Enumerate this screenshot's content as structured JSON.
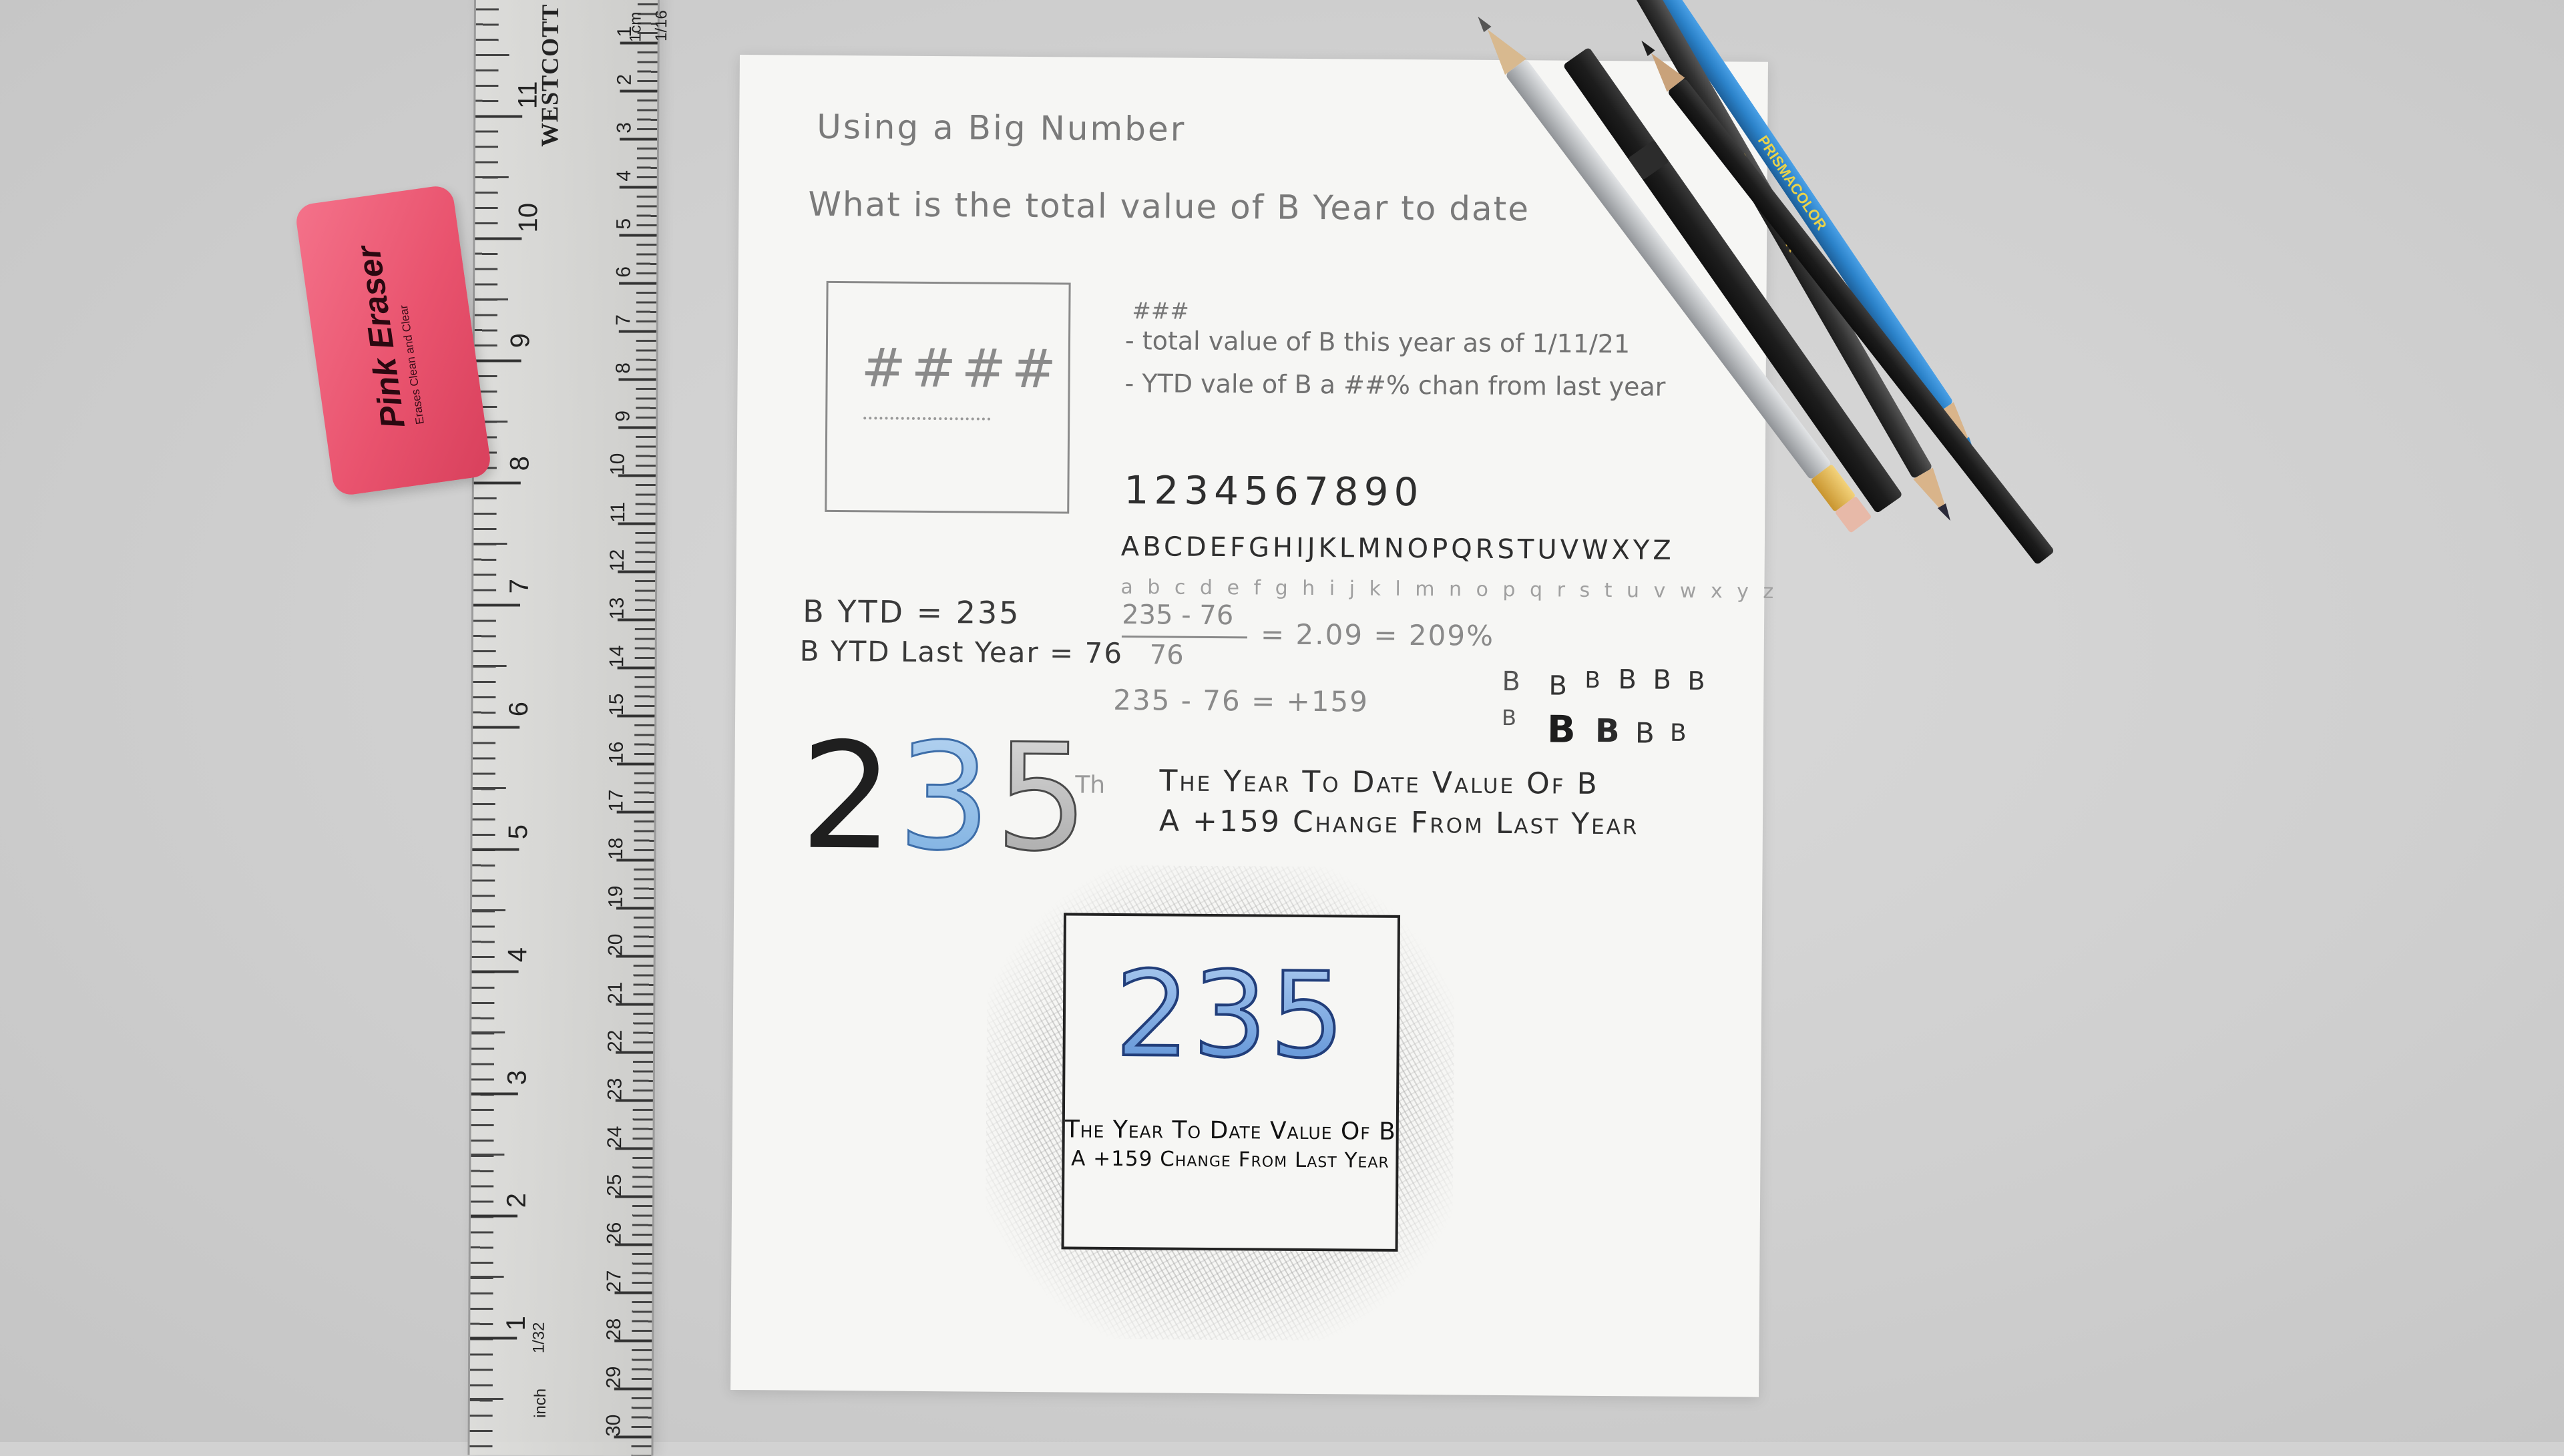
{
  "desk": {
    "color": "#d2d2d2"
  },
  "ruler": {
    "brand": "WESTCOTT",
    "unit_top": "1cm",
    "unit_bottom": "inch",
    "fraction_label": "1/32",
    "small_label": "1/16",
    "inch_numbers": [
      "11",
      "10",
      "9",
      "8",
      "7",
      "6",
      "5",
      "4",
      "3",
      "2",
      "1"
    ],
    "cm_numbers": [
      "1",
      "2",
      "3",
      "4",
      "5",
      "6",
      "7",
      "8",
      "9",
      "10",
      "11",
      "12",
      "13",
      "14",
      "15",
      "16",
      "17",
      "18",
      "19",
      "20",
      "21",
      "22",
      "23",
      "24",
      "25",
      "26",
      "27",
      "28",
      "29",
      "30"
    ]
  },
  "eraser": {
    "title": "Pink Eraser",
    "subtitle": "Erases Clean and Clear",
    "color": "#e9536e"
  },
  "paper": {
    "title": "Using a Big Number",
    "question": "What is the total value of B Year to date",
    "sketch_box": {
      "placeholder": "####"
    },
    "notes": {
      "hash": "###",
      "line1": "- total value of B this year as of 1/11/21",
      "line2": "- YTD vale of B a ##% chan from last year"
    },
    "alphabet": {
      "digits": "1234567890",
      "uppercase": "ABCDEFGHIJKLMNOPQRSTUVWXYZ",
      "lowercase": "a b c d e f g h i j k l m n o p q r s t u v w x y z"
    },
    "calc": {
      "ytd": "B YTD = 235",
      "last_year": "B YTD Last Year = 76",
      "fraction_numerator": "235 - 76",
      "fraction_denominator": "76",
      "fraction_result": "= 2.09 = 209%",
      "difference": "235 - 76 = +159"
    },
    "b_samples": [
      "B",
      "B",
      "B",
      "B",
      "B",
      "B",
      "B",
      "B",
      "B",
      "B",
      "B",
      "B"
    ],
    "big_number_sketch": {
      "digit1": "2",
      "digit2": "3",
      "digit3": "5",
      "scribble": "Th"
    },
    "caption": {
      "line1": "The Year To Date Value Of B",
      "line2": "A +159 Change From Last Year"
    },
    "final_card": {
      "number": "235",
      "line1": "The Year To Date Value Of B",
      "line2": "A +159 Change From Last Year",
      "number_color": "#5e92d6"
    }
  },
  "pencils": [
    {
      "name": "silver",
      "color": "#c4c6c8"
    },
    {
      "name": "black",
      "color": "#2a2a2a"
    },
    {
      "name": "dark-gray",
      "color": "#333333"
    },
    {
      "name": "blue",
      "color": "#2b82c9"
    }
  ]
}
